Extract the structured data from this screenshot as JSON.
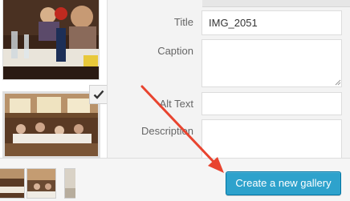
{
  "attachment_details": {
    "title_label": "Title",
    "title_value": "IMG_2051",
    "caption_label": "Caption",
    "caption_value": "",
    "alt_text_label": "Alt Text",
    "alt_text_value": "",
    "description_label": "Description",
    "description_value": ""
  },
  "attachments": [
    {
      "icon": "photo-thumbnail",
      "selected": false
    },
    {
      "icon": "photo-thumbnail",
      "selected": true
    }
  ],
  "selection_bar": {
    "thumbnails": [
      "photo-thumbnail",
      "photo-thumbnail",
      "photo-thumbnail"
    ]
  },
  "toolbar": {
    "primary_button_label": "Create a new gallery"
  },
  "colors": {
    "primary_button": "#2ea2cc",
    "annotation_arrow": "#e8442f",
    "details_background": "#f3f3f3"
  },
  "icons": {
    "selected_check": "checkmark-icon",
    "annotation": "red-arrow-annotation"
  }
}
